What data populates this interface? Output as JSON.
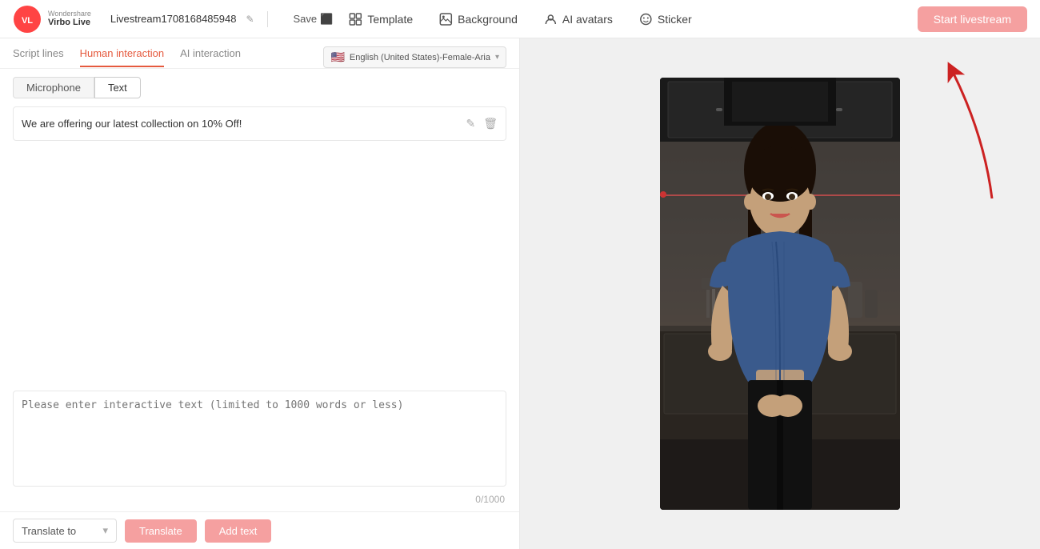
{
  "app": {
    "logo_text": "Wondershare\nVirbo Live",
    "project_name": "Livestream1708168485948",
    "save_label": "Save"
  },
  "header": {
    "nav_items": [
      {
        "id": "template",
        "label": "Template",
        "icon": "template-icon"
      },
      {
        "id": "background",
        "label": "Background",
        "icon": "background-icon"
      },
      {
        "id": "ai-avatars",
        "label": "AI avatars",
        "icon": "ai-avatars-icon"
      },
      {
        "id": "sticker",
        "label": "Sticker",
        "icon": "sticker-icon"
      }
    ],
    "start_button_label": "Start livestream"
  },
  "left_panel": {
    "tabs": [
      {
        "id": "script-lines",
        "label": "Script lines"
      },
      {
        "id": "human-interaction",
        "label": "Human interaction",
        "active": true
      },
      {
        "id": "ai-interaction",
        "label": "AI interaction"
      }
    ],
    "voice_selector": {
      "flag": "🇺🇸",
      "value": "English (United States)-Female-Aria"
    },
    "sub_tabs": [
      {
        "id": "microphone",
        "label": "Microphone"
      },
      {
        "id": "text",
        "label": "Text",
        "active": true
      }
    ],
    "script_items": [
      {
        "id": 1,
        "text": "We are offering our latest collection on 10% Off!"
      }
    ],
    "text_input": {
      "placeholder": "Please enter interactive text (limited to 1000 words or less)",
      "char_count": "0/1000"
    },
    "translate_to_label": "Translate to",
    "translate_button_label": "Translate",
    "add_text_button_label": "Add text"
  }
}
